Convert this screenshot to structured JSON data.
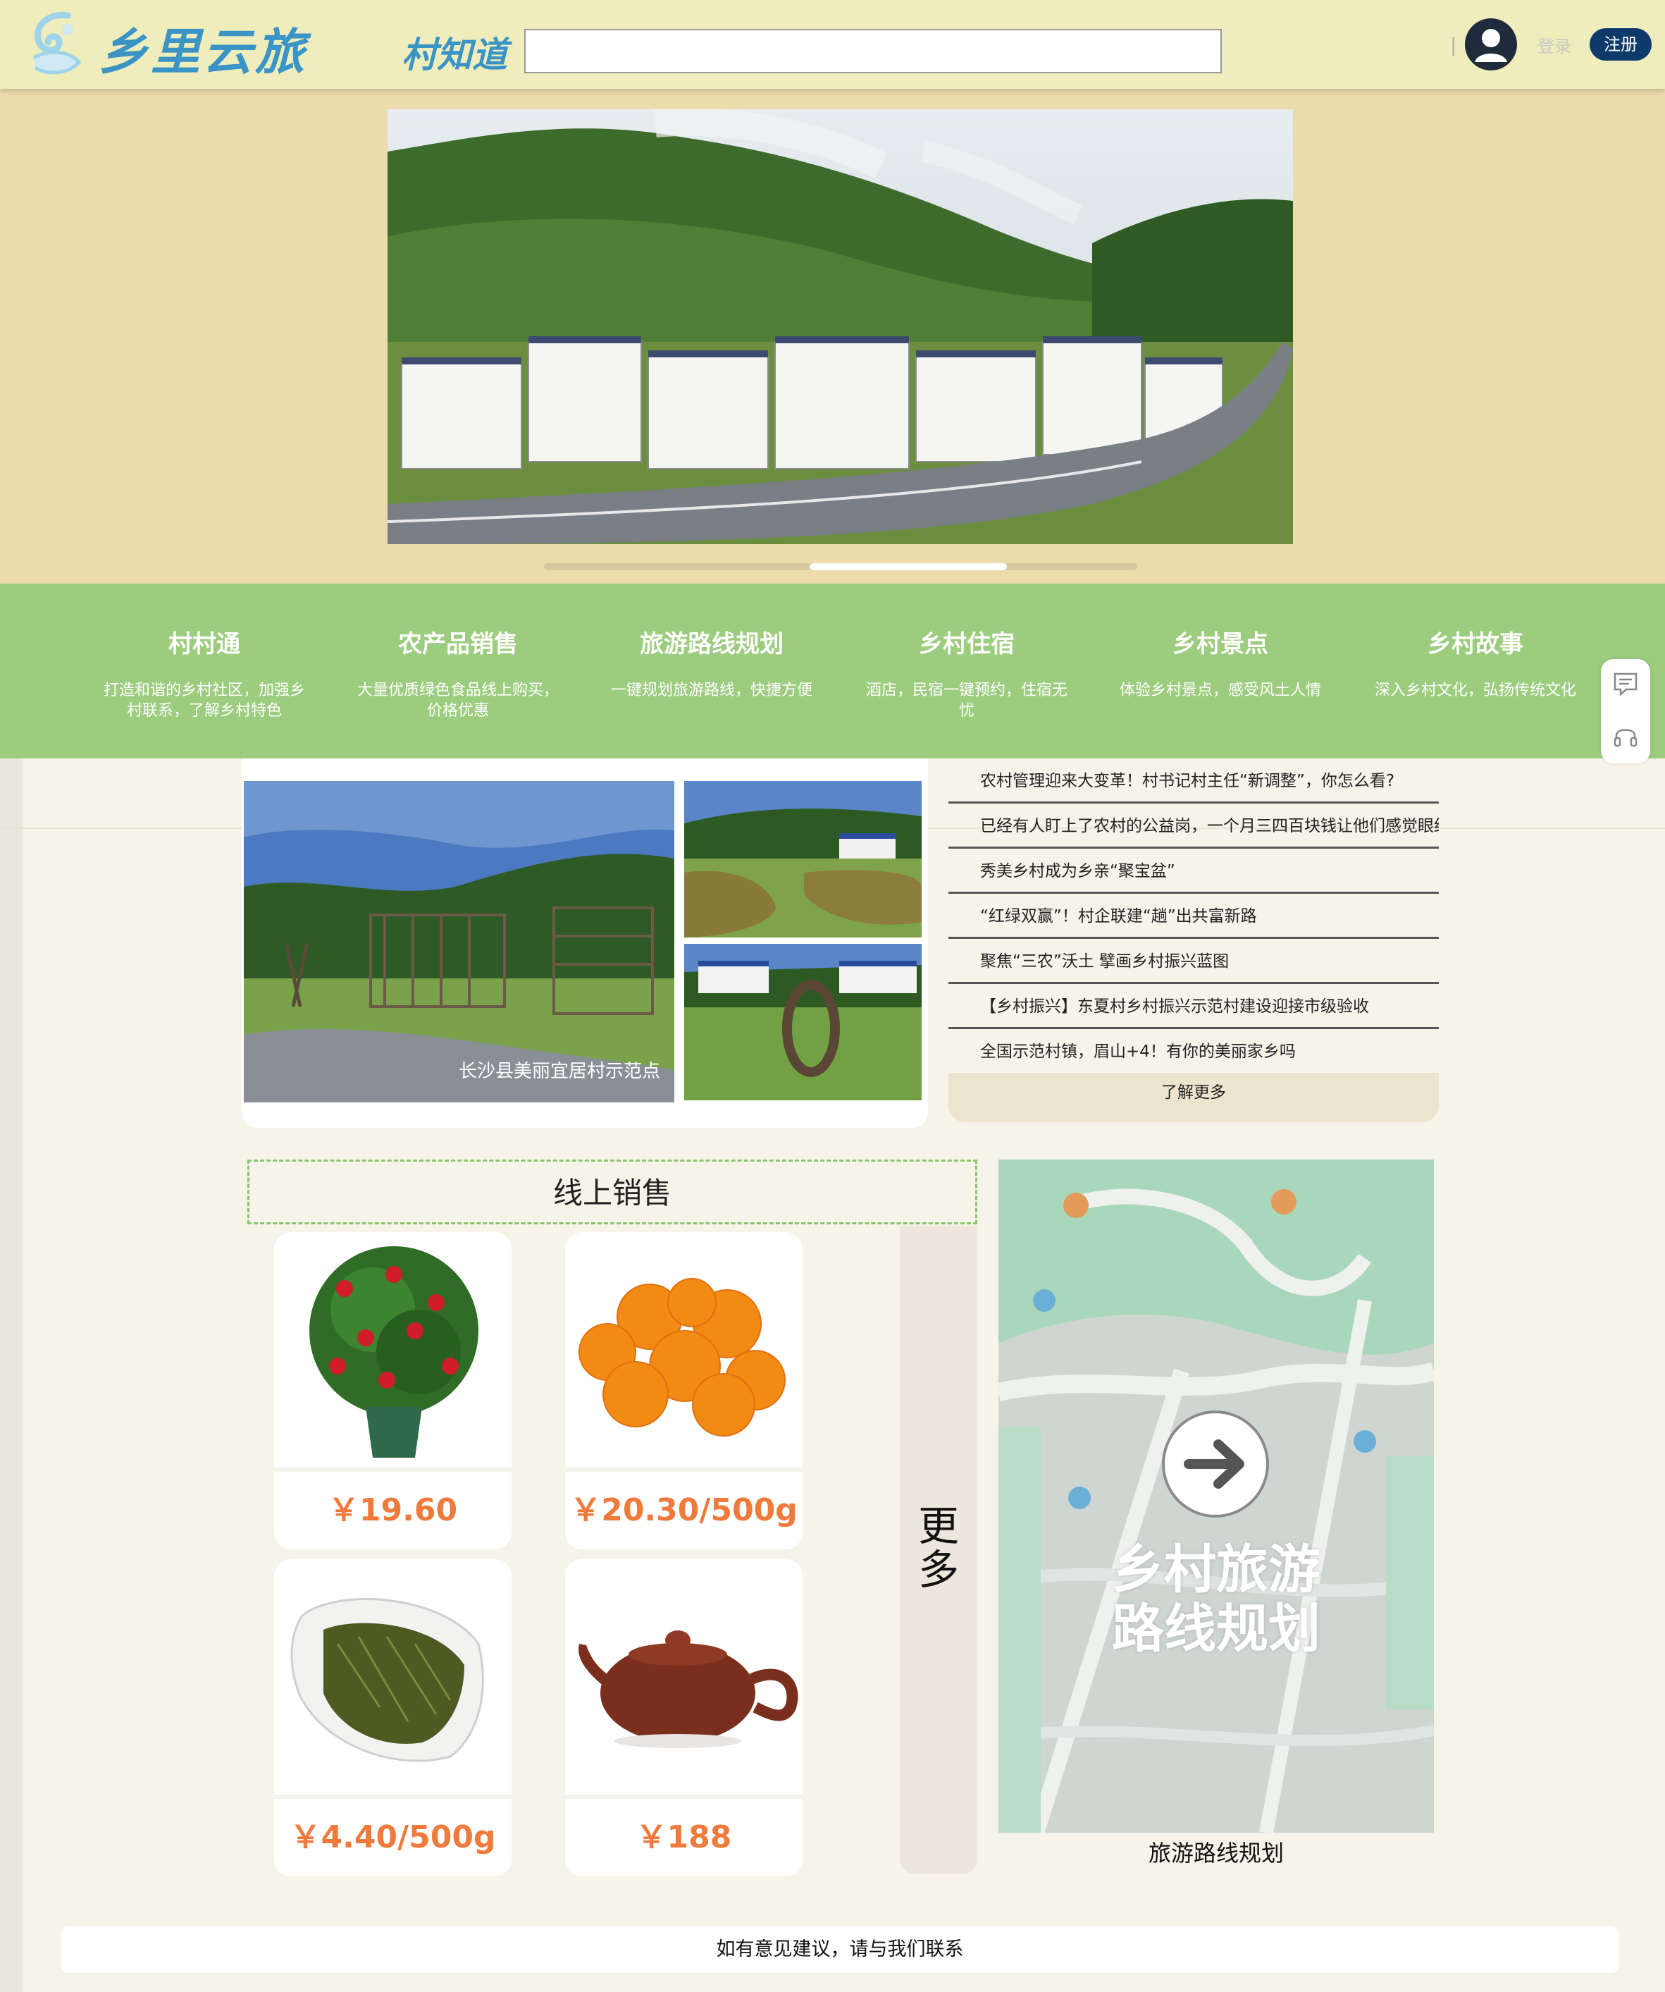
{
  "header": {
    "logo_text": "乡里云旅",
    "nav_brand": "村知道",
    "search": {
      "value": "",
      "placeholder": ""
    },
    "divider": "|",
    "login_label": "登录",
    "register_label": "注册"
  },
  "hero": {
    "carousel_progress": 0.67
  },
  "features": [
    {
      "title": "村村通",
      "desc": "打造和谐的乡村社区，加强乡村联系，了解乡村特色"
    },
    {
      "title": "农产品销售",
      "desc": "大量优质绿色食品线上购买，价格优惠"
    },
    {
      "title": "旅游路线规划",
      "desc": "一键规划旅游路线，快捷方便"
    },
    {
      "title": "乡村住宿",
      "desc": "酒店，民宿一键预约，住宿无忧"
    },
    {
      "title": "乡村景点",
      "desc": "体验乡村景点，感受风土人情"
    },
    {
      "title": "乡村故事",
      "desc": "深入乡村文化，弘扬传统文化"
    }
  ],
  "photos": {
    "main_caption": "长沙县美丽宜居村示范点"
  },
  "news": {
    "items": [
      "农村管理迎来大变革！村书记村主任“新调整”，你怎么看?",
      "已经有人盯上了农村的公益岗，一个月三四百块钱让他们感觉眼红",
      "秀美乡村成为乡亲“聚宝盆”",
      "“红绿双赢”！村企联建“趟”出共富新路",
      "聚焦“三农”沃土 擘画乡村振兴蓝图",
      "【乡村振兴】东夏村乡村振兴示范村建设迎接市级验收",
      "全国示范村镇，眉山+4！有你的美丽家乡吗"
    ],
    "more_label": "了解更多"
  },
  "sales": {
    "title": "线上销售",
    "more_label": "更多",
    "products": [
      {
        "icon": "camellia-plant-icon",
        "price": "￥19.60"
      },
      {
        "icon": "oranges-icon",
        "price": "￥20.30/500g"
      },
      {
        "icon": "green-tea-icon",
        "price": "￥4.40/500g"
      },
      {
        "icon": "clay-teapot-icon",
        "price": "￥188"
      }
    ]
  },
  "map": {
    "overlay_line1": "乡村旅游",
    "overlay_line2": "路线规划",
    "label": "旅游路线规划"
  },
  "footer": {
    "text": "如有意见建议，请与我们联系"
  },
  "colors": {
    "header_bg": "#eeedbb",
    "hero_bg": "#ecdcac",
    "feature_bg": "#9ccc7e",
    "brand_blue": "#3b94c6",
    "price_orange": "#f07a3c",
    "register_blue": "#0e3a6b"
  }
}
